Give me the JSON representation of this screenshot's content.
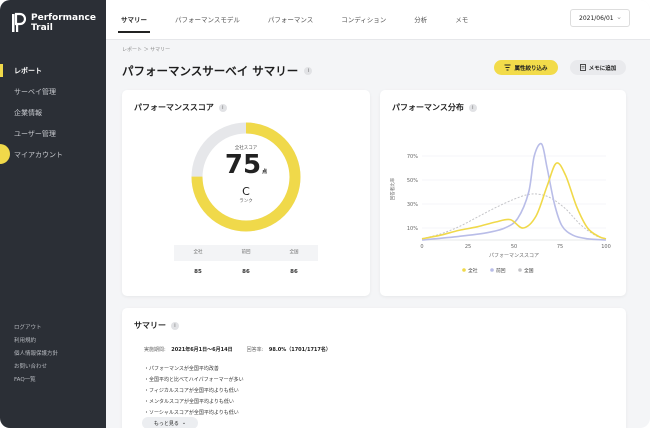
{
  "brand": {
    "line1": "Performance",
    "line2": "Trail"
  },
  "sidebar": {
    "items": [
      {
        "label": "レポート"
      },
      {
        "label": "サーベイ管理"
      },
      {
        "label": "企業情報"
      },
      {
        "label": "ユーザー管理"
      },
      {
        "label": "マイアカウント"
      }
    ],
    "footer": [
      {
        "label": "ログアウト"
      },
      {
        "label": "利用規約"
      },
      {
        "label": "個人情報保護方針"
      },
      {
        "label": "お問い合わせ"
      },
      {
        "label": "FAQ一覧"
      }
    ]
  },
  "tabs": [
    {
      "label": "サマリー"
    },
    {
      "label": "パフォーマンスモデル"
    },
    {
      "label": "パフォーマンス"
    },
    {
      "label": "コンディション"
    },
    {
      "label": "分析"
    },
    {
      "label": "メモ"
    }
  ],
  "date_select": {
    "value": "2021/06/01",
    "chevron": "⌄"
  },
  "breadcrumb": "レポート ＞ サマリー",
  "page_title": "パフォーマンスサーベイ サマリー",
  "info_icon": "i",
  "buttons": {
    "filter": "属性絞り込み",
    "memo": "メモに追加"
  },
  "score_card": {
    "title": "パフォーマンススコア",
    "gauge_label": "全社スコア",
    "score": "75",
    "unit": "点",
    "rank": "C",
    "rank_label": "ランク",
    "score_fraction": 0.75,
    "headers": [
      "全社",
      "前回",
      "全国"
    ],
    "values": [
      "85",
      "86",
      "86"
    ]
  },
  "dist_card": {
    "title": "パフォーマンス分布"
  },
  "chart_data": {
    "type": "line",
    "xlabel": "パフォーマンススコア",
    "ylabel": "回答者比率",
    "x_ticks": [
      0,
      25,
      50,
      75,
      100
    ],
    "y_ticks": [
      "10%",
      "30%",
      "50%",
      "70%"
    ],
    "y_tick_values": [
      10,
      30,
      50,
      70
    ],
    "xlim": [
      0,
      100
    ],
    "ylim": [
      0,
      85
    ],
    "legend": "bottom",
    "series": [
      {
        "name": "全社",
        "color": "#f0d94a",
        "style": "solid",
        "x": [
          0,
          10,
          20,
          30,
          40,
          48,
          55,
          62,
          68,
          73,
          78,
          84,
          90,
          96,
          100
        ],
        "y": [
          1,
          4,
          8,
          11,
          15,
          17,
          10,
          20,
          45,
          64,
          54,
          28,
          10,
          3,
          1
        ]
      },
      {
        "name": "前回",
        "color": "#b9bde8",
        "style": "solid",
        "x": [
          0,
          20,
          35,
          45,
          52,
          58,
          61,
          65,
          68,
          72,
          76,
          82,
          90,
          100
        ],
        "y": [
          0,
          3,
          6,
          10,
          18,
          40,
          70,
          80,
          60,
          30,
          12,
          4,
          1,
          0
        ]
      },
      {
        "name": "全国",
        "color": "#c4c4c8",
        "style": "dashed",
        "x": [
          0,
          10,
          20,
          30,
          40,
          50,
          58,
          64,
          70,
          78,
          86,
          94,
          100
        ],
        "y": [
          1,
          5,
          11,
          19,
          27,
          34,
          38,
          38,
          35,
          26,
          13,
          4,
          1
        ]
      }
    ]
  },
  "summary": {
    "title": "サマリー",
    "period_label": "実施期間:",
    "period": "2021年6月1日〜6月14日",
    "response_label": "回答率:",
    "response": "98.0%（1701/1717名）",
    "bullets": [
      "・パフォーマンスが全国平均改善",
      "・全国平均と比べてハイパフォーマーが多い",
      "・フィジカルスコアが全国平均よりも低い",
      "・メンタルスコアが全国平均よりも低い",
      "・ソーシャルスコアが全国平均よりも低い"
    ],
    "more_label": "もっと見る",
    "more_icon": "⌄"
  }
}
